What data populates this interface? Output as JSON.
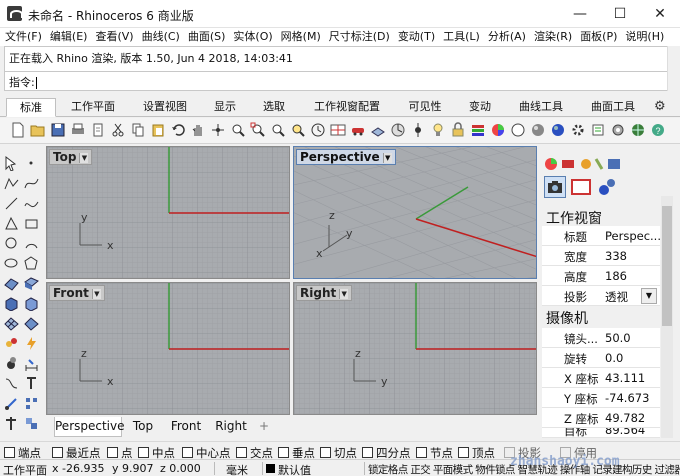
{
  "window": {
    "title": "未命名 - Rhinoceros 6 商业版",
    "minimize": "—",
    "maximize": "☐",
    "close": "✕"
  },
  "menu": [
    "文件(F)",
    "编辑(E)",
    "查看(V)",
    "曲线(C)",
    "曲面(S)",
    "实体(O)",
    "网格(M)",
    "尺寸标注(D)",
    "变动(T)",
    "工具(L)",
    "分析(A)",
    "渲染(R)",
    "面板(P)",
    "说明(H)"
  ],
  "command": {
    "history": "正在载入 Rhino 渲染, 版本 1.50, Jun  4 2018, 14:03:41",
    "prompt": "指令:"
  },
  "tabs": [
    {
      "label": "标准",
      "active": true
    },
    {
      "label": "工作平面",
      "active": false
    },
    {
      "label": "设置视图",
      "active": false
    },
    {
      "label": "显示",
      "active": false
    },
    {
      "label": "选取",
      "active": false
    },
    {
      "label": "工作视窗配置",
      "active": false
    },
    {
      "label": "可见性",
      "active": false
    },
    {
      "label": "变动",
      "active": false
    },
    {
      "label": "曲线工具",
      "active": false
    },
    {
      "label": "曲面工具",
      "active": false
    }
  ],
  "viewports": {
    "top": {
      "label": "Top",
      "active": false
    },
    "perspective": {
      "label": "Perspective",
      "active": true
    },
    "front": {
      "label": "Front",
      "active": false
    },
    "right": {
      "label": "Right",
      "active": false
    }
  },
  "axes": {
    "x": "x",
    "y": "y",
    "z": "z"
  },
  "viewport_tabs": [
    {
      "label": "Perspective",
      "active": true
    },
    {
      "label": "Top",
      "active": false
    },
    {
      "label": "Front",
      "active": false
    },
    {
      "label": "Right",
      "active": false
    },
    {
      "label": "+",
      "active": false
    }
  ],
  "properties": {
    "section_viewport": "工作视窗",
    "rows1": [
      {
        "label": "标题",
        "value": "Perspec..."
      },
      {
        "label": "宽度",
        "value": "338"
      },
      {
        "label": "高度",
        "value": "186"
      },
      {
        "label": "投影",
        "value": "透视"
      }
    ],
    "section_camera": "摄像机",
    "rows2": [
      {
        "label": "镜头...",
        "value": "50.0"
      },
      {
        "label": "旋转",
        "value": "0.0"
      },
      {
        "label": "X 座标",
        "value": "43.111"
      },
      {
        "label": "Y 座标",
        "value": "-74.673"
      },
      {
        "label": "Z 座标",
        "value": "49.782"
      },
      {
        "label": "目标",
        "value": "89.564"
      }
    ]
  },
  "osnap": [
    {
      "label": "端点",
      "checked": false,
      "disabled": false
    },
    {
      "label": "最近点",
      "checked": false,
      "disabled": false
    },
    {
      "label": "点",
      "checked": false,
      "disabled": false
    },
    {
      "label": "中点",
      "checked": false,
      "disabled": false
    },
    {
      "label": "中心点",
      "checked": false,
      "disabled": false
    },
    {
      "label": "交点",
      "checked": false,
      "disabled": false
    },
    {
      "label": "垂点",
      "checked": false,
      "disabled": false
    },
    {
      "label": "切点",
      "checked": false,
      "disabled": false
    },
    {
      "label": "四分点",
      "checked": false,
      "disabled": false
    },
    {
      "label": "节点",
      "checked": false,
      "disabled": false
    },
    {
      "label": "顶点",
      "checked": false,
      "disabled": false
    },
    {
      "label": "投影",
      "checked": false,
      "disabled": true
    },
    {
      "label": "停用",
      "checked": false,
      "disabled": true
    }
  ],
  "status": {
    "cplane": "工作平面",
    "x": "x -26.935",
    "y": "y 9.907",
    "z": "z 0.000",
    "units": "毫米",
    "layer": "默认值",
    "toggles": "锁定格点 正交 平面模式 物件锁点 智慧轨迹 操作轴 记录建构历史 过滤器"
  },
  "watermark": "zhanshaoyi.com"
}
